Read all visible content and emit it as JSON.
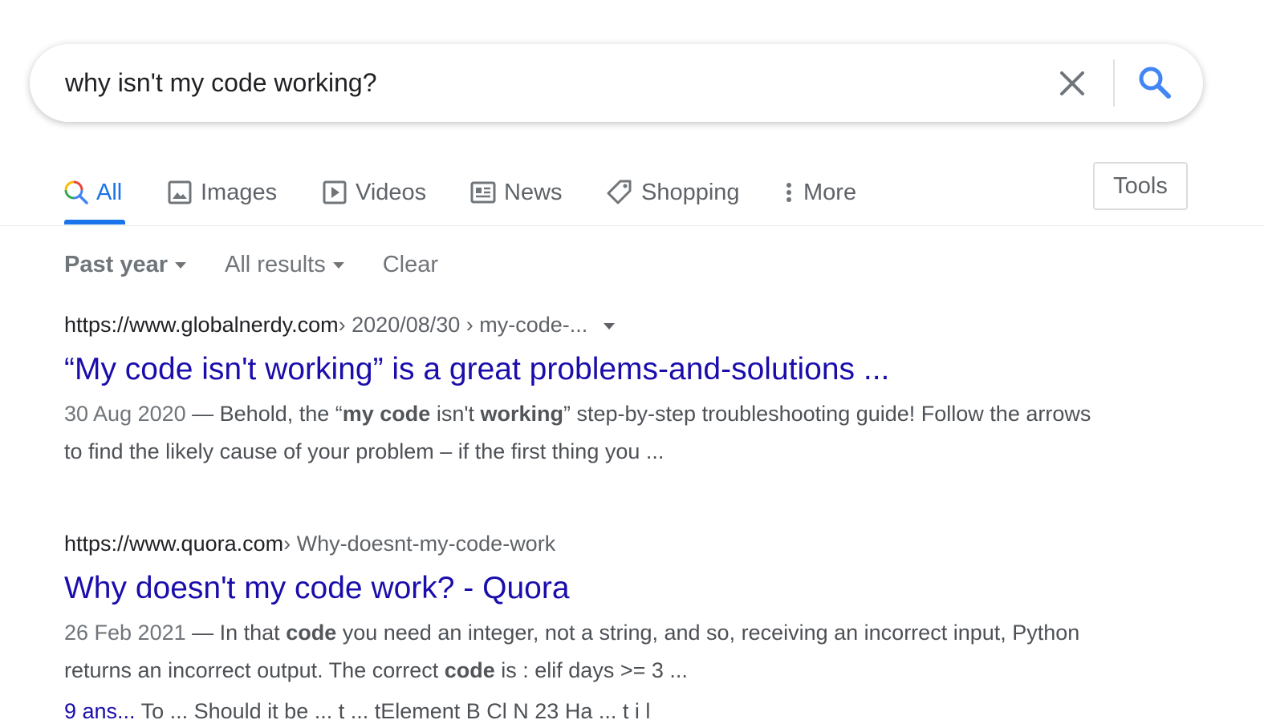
{
  "search": {
    "query": "why isn't my code working?",
    "clear_icon": "close-icon",
    "submit_icon": "search-icon"
  },
  "tabs": [
    {
      "label": "All",
      "icon": "search-multicolor-icon",
      "active": true
    },
    {
      "label": "Images",
      "icon": "image-icon"
    },
    {
      "label": "Videos",
      "icon": "play-icon"
    },
    {
      "label": "News",
      "icon": "newspaper-icon"
    },
    {
      "label": "Shopping",
      "icon": "tag-icon"
    },
    {
      "label": "More",
      "icon": "more-vert-icon"
    }
  ],
  "tools_label": "Tools",
  "filters": {
    "time": "Past year",
    "results": "All results",
    "clear": "Clear"
  },
  "results": [
    {
      "url": "https://www.globalnerdy.com",
      "path": " › 2020/08/30 › my-code-...",
      "title": "“My code isn't working” is a great problems-and-solutions ...",
      "date": "30 Aug 2020",
      "snippet_parts": [
        " — Behold, the “",
        "my code",
        " isn't ",
        "working",
        "” step-by-step troubleshooting guide! Follow the arrows to find the likely cause of your problem – if the first thing you ..."
      ]
    },
    {
      "url": "https://www.quora.com",
      "path": " › Why-doesnt-my-code-work",
      "title": "Why doesn't my code work? - Quora",
      "date": "26 Feb 2021",
      "snippet_parts": [
        " — In that ",
        "code",
        " you need an integer, not a string, and so, receiving an incorrect input, Python returns an incorrect output. The correct ",
        "code",
        " is : elif days >= 3 ..."
      ]
    }
  ],
  "cutoff_line": {
    "link_fragment": "9 ans...",
    "text": "   To ...      Should it be ...     t ...  tElement  B  Cl   N    23 Ha  ...     t i  l"
  },
  "colors": {
    "link": "#1a0dab",
    "accent": "#1a73e8",
    "muted": "#70757a"
  }
}
